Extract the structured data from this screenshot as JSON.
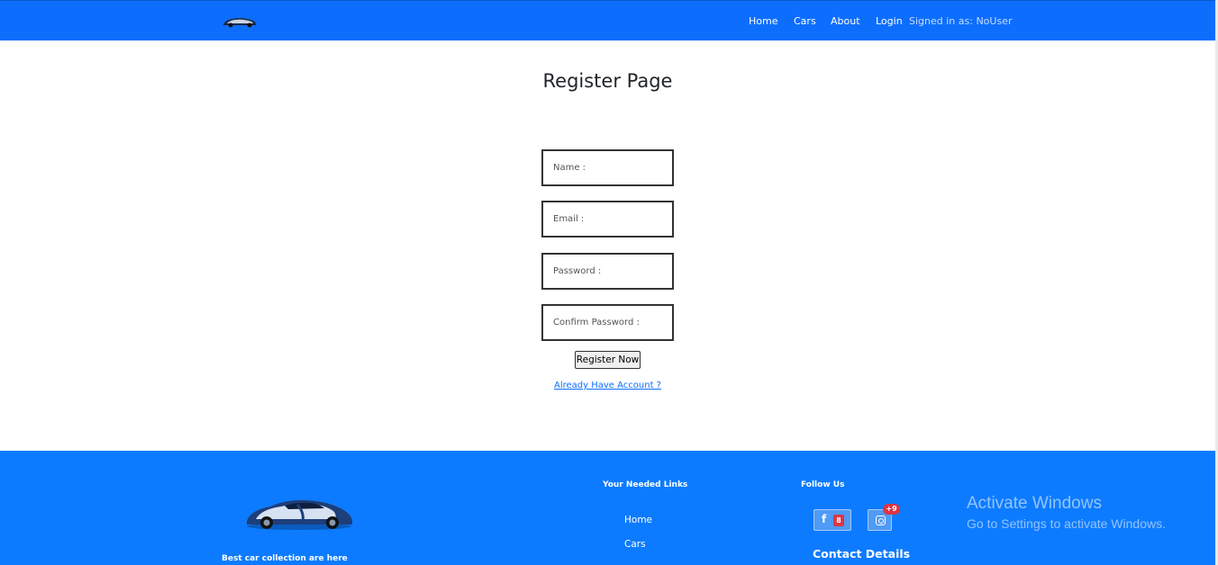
{
  "navbar": {
    "logo_icon": "car-logo-icon",
    "links": [
      "Home",
      "Cars",
      "About",
      "Login"
    ],
    "signed_in": "Signed in as: NoUser",
    "color": "#0d6efd"
  },
  "register": {
    "title": "Register Page",
    "fields": {
      "name": {
        "placeholder": "Name :",
        "value": ""
      },
      "email": {
        "placeholder": "Email :",
        "value": ""
      },
      "password": {
        "placeholder": "Password :",
        "value": ""
      },
      "confirm": {
        "placeholder": "Confirm Password :",
        "value": ""
      }
    },
    "button": "Register Now",
    "login_link": "Already Have Account ?"
  },
  "footer": {
    "tagline": "Best car collection are here",
    "car_image_icon": "sports-car-icon",
    "links_heading": "Your Needed Links",
    "links": [
      "Home",
      "Cars"
    ],
    "follow_heading": "Follow Us",
    "social": [
      {
        "icon": "facebook-icon",
        "badge": "8"
      },
      {
        "icon": "instagram-icon",
        "badge": "+9"
      }
    ],
    "contact_heading": "Contact Details",
    "color": "#0d7bff"
  },
  "watermark": {
    "title": "Activate Windows",
    "subtitle": "Go to Settings to activate Windows."
  }
}
